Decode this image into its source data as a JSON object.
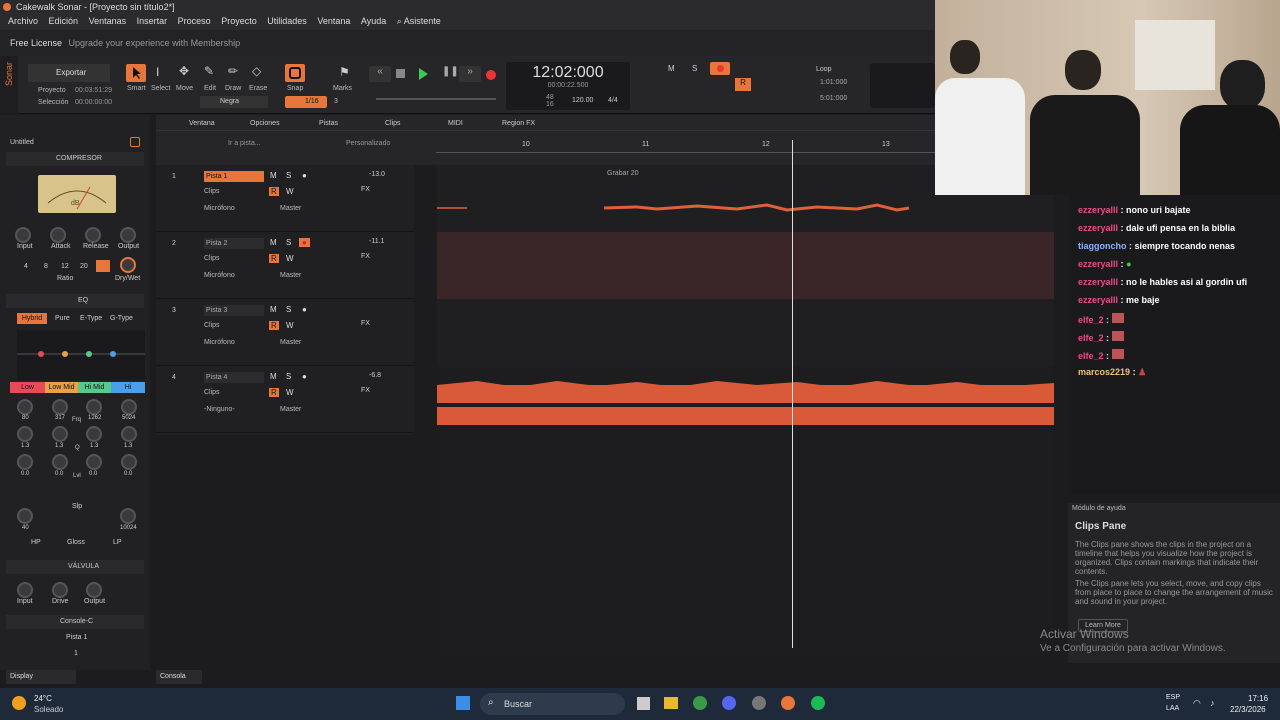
{
  "window": {
    "title": "Cakewalk Sonar - [Proyecto sin título2*]"
  },
  "menu": [
    "Archivo",
    "Edición",
    "Ventanas",
    "Insertar",
    "Proceso",
    "Proyecto",
    "Utilidades",
    "Ventana",
    "Ayuda",
    "⌕ Asistente"
  ],
  "license": {
    "label": "Free License",
    "upgrade": "Upgrade your experience with Membership"
  },
  "control": {
    "export": "Exportar",
    "proyecto": "Proyecto",
    "proyecto_time": "00:03:51:29",
    "seleccion": "Selección",
    "seleccion_time": "00:00:00:00",
    "tools": [
      "Smart",
      "Select",
      "Move",
      "Edit",
      "Draw",
      "Erase"
    ],
    "snap": "Snap",
    "snap_value": "1/16",
    "snap_num": "3",
    "marks": "Marks",
    "color": "Negra",
    "time": "12:02:000",
    "time_sub": "00:00:22.500",
    "tempo": "120.00",
    "meter": "4/4",
    "sig_top": "48",
    "sig_bottom": "16",
    "loop": "Loop",
    "loop_start": "1:01:000",
    "loop_end": "5:01:000"
  },
  "arrange_menu": [
    "Ventana",
    "Opciones",
    "Pistas",
    "Clips",
    "MIDI",
    "Region FX"
  ],
  "goto": "Ir a pista...",
  "view": "Personalizado",
  "ruler": [
    "10",
    "11",
    "12",
    "13"
  ],
  "rack": {
    "file": "Untitled",
    "compressor": "COMPRESOR",
    "comp_knobs": [
      "Input",
      "Attack",
      "Release",
      "Output"
    ],
    "ratios": [
      "4",
      "8",
      "12",
      "20"
    ],
    "ratio": "Ratio",
    "drywet": "Dry/Wet",
    "eq": "EQ",
    "eq_modes": [
      "Hybrid",
      "Pure",
      "E-Type",
      "G-Type"
    ],
    "bands": [
      "Low",
      "Low Mid",
      "Hi Mid",
      "Hi"
    ],
    "freqs": [
      "80",
      "317",
      "Frq",
      "1262",
      "5024"
    ],
    "qs": [
      "1.3",
      "1.3",
      "Q",
      "1.3",
      "1.3"
    ],
    "lvls": [
      "0.0",
      "0.0",
      "Lvl",
      "0.0",
      "0.0"
    ],
    "slp": "Slp",
    "hp_freq": "40",
    "lp_freq": "10024",
    "filters": [
      "HP",
      "Gloss",
      "LP"
    ],
    "valve": "VÁLVULA",
    "valve_knobs": [
      "Input",
      "Drive",
      "Output"
    ],
    "console": "Console-C",
    "console_track": "Pista 1",
    "console_num": "1"
  },
  "tracks": [
    {
      "num": "1",
      "name": "Pista 1",
      "vol": "-13.0",
      "clips": "Clips",
      "input": "Micrófono",
      "out": "Master",
      "selected": true
    },
    {
      "num": "2",
      "name": "Pista 2",
      "vol": "-11.1",
      "clips": "Clips",
      "input": "Micrófono",
      "out": "Master",
      "selected": false
    },
    {
      "num": "3",
      "name": "Pista 3",
      "vol": "",
      "clips": "Clips",
      "input": "Micrófono",
      "out": "Master",
      "selected": false
    },
    {
      "num": "4",
      "name": "Pista 4",
      "vol": "-6.8",
      "clips": "Clips",
      "input": "-Ninguno-",
      "out": "Master",
      "selected": false
    }
  ],
  "clip_label": "Grabar 20",
  "chat": [
    {
      "user": "ezzeryalll",
      "msg": ": nono uri bajate"
    },
    {
      "user": "ezzeryalll",
      "msg": ": dale ufi pensa en la biblia"
    },
    {
      "user": "tiaggoncho",
      "msg": ": siempre tocando nenas"
    },
    {
      "user": "ezzeryalll",
      "msg": ":"
    },
    {
      "user": "ezzeryalll",
      "msg": ": no le hables asi al gordin ufi"
    },
    {
      "user": "ezzeryalll",
      "msg": ": me baje"
    },
    {
      "user": "elfe_2",
      "msg": ":"
    },
    {
      "user": "elfe_2",
      "msg": ":"
    },
    {
      "user": "elfe_2",
      "msg": ":"
    },
    {
      "user": "marcos2219",
      "msg": ":"
    }
  ],
  "help": {
    "header": "Módulo de ayuda",
    "title": "Clips Pane",
    "p1": "The Clips pane shows the clips in the project on a timeline that helps you visualize how the project is organized. Clips contain markings that indicate their contents.",
    "p2": "The Clips pane lets you select, move, and copy clips from place to place to change the arrangement of music and sound in your project.",
    "learn": "Learn More"
  },
  "activate": {
    "line1": "Activar Windows",
    "line2": "Ve a Configuración para activar Windows."
  },
  "console_tab": "Consola",
  "display": "Display",
  "taskbar": {
    "temp": "24°C",
    "weather": "Soleado",
    "search": "Buscar",
    "lang1": "ESP",
    "lang2": "LAA",
    "time": "17:16",
    "date": "22/3/2026"
  }
}
